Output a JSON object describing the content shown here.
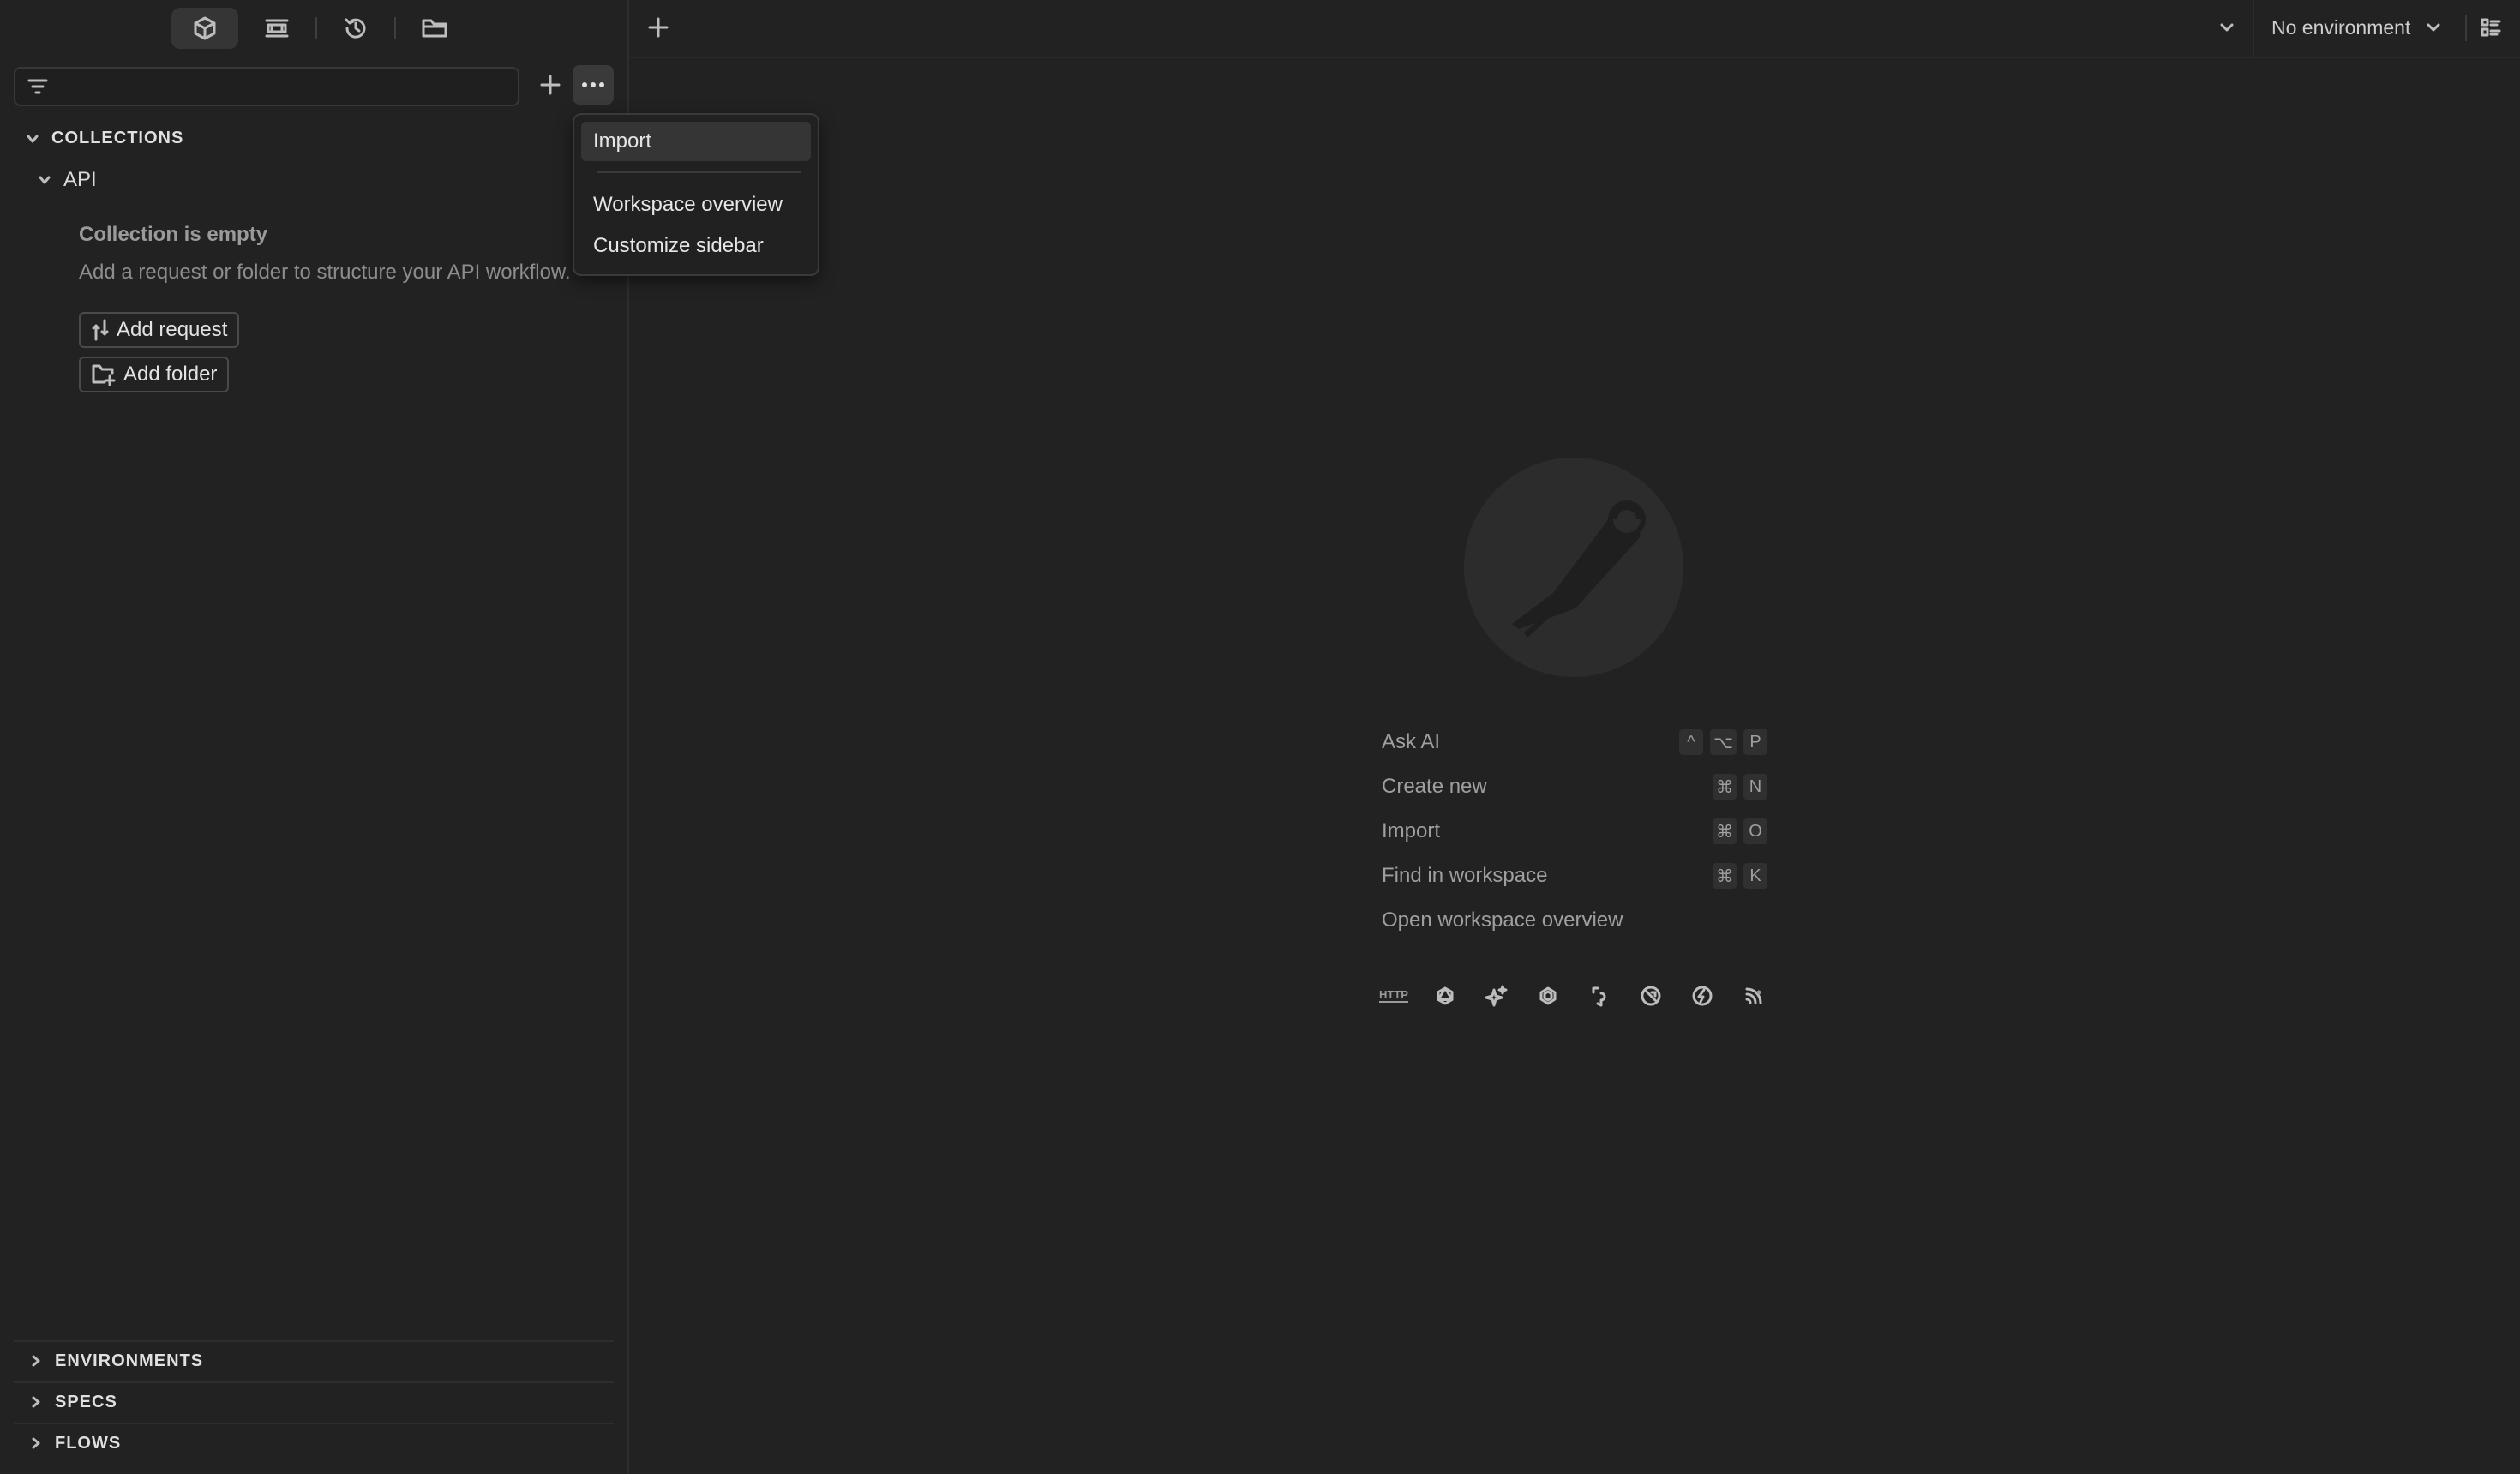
{
  "sidebar": {
    "tabs": [
      {
        "icon": "collections-icon"
      },
      {
        "icon": "environments-icon"
      },
      {
        "icon": "history-icon"
      },
      {
        "icon": "folder-icon"
      }
    ],
    "filter": {
      "placeholder": "",
      "value": ""
    },
    "collections_heading": "COLLECTIONS",
    "collection": {
      "name": "API",
      "empty_title": "Collection is empty",
      "empty_desc": "Add a request or folder to structure your API workflow.",
      "add_request_label": "Add request",
      "add_folder_label": "Add folder"
    },
    "bottom_sections": [
      "ENVIRONMENTS",
      "SPECS",
      "FLOWS"
    ]
  },
  "menu": {
    "items": [
      "Import",
      "Workspace overview",
      "Customize sidebar"
    ]
  },
  "topbar": {
    "environment": "No environment"
  },
  "launchpad": {
    "shortcuts": [
      {
        "label": "Ask AI",
        "keys": [
          "^",
          "⌥",
          "P"
        ]
      },
      {
        "label": "Create new",
        "keys": [
          "⌘",
          "N"
        ]
      },
      {
        "label": "Import",
        "keys": [
          "⌘",
          "O"
        ]
      },
      {
        "label": "Find in workspace",
        "keys": [
          "⌘",
          "K"
        ]
      },
      {
        "label": "Open workspace overview",
        "keys": []
      }
    ],
    "protocol_http": "HTTP",
    "protocols": [
      "http-icon",
      "graphql-icon",
      "ai-icon",
      "grpc-icon",
      "websocket-icon",
      "socketio-icon",
      "mqtt-icon",
      "sse-icon"
    ]
  },
  "colors": {
    "background": "#222222",
    "menu_highlight": "#353535"
  }
}
